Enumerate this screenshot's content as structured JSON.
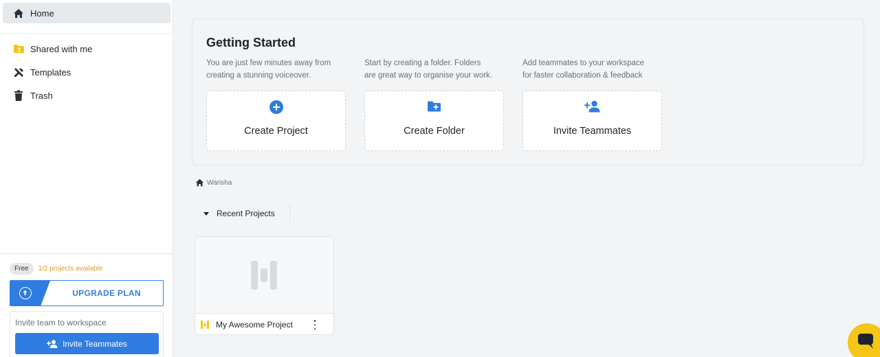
{
  "sidebar": {
    "items": [
      {
        "label": "Home",
        "icon": "home-icon"
      },
      {
        "label": "Shared with me",
        "icon": "shared-folder-icon"
      },
      {
        "label": "Templates",
        "icon": "templates-tools-icon"
      },
      {
        "label": "Trash",
        "icon": "trash-icon"
      }
    ],
    "plan_badge": "Free",
    "plan_status": "1/2 projects available",
    "upgrade_label": "UPGRADE PLAN",
    "invite_label": "Invite team to workspace",
    "invite_button": "Invite Teammates"
  },
  "getting_started": {
    "title": "Getting Started",
    "columns": [
      {
        "desc_line1": "You are just few minutes away from",
        "desc_line2": "creating a stunning voiceover.",
        "card_label": "Create Project",
        "icon": "plus-circle-icon"
      },
      {
        "desc_line1": "Start by creating a folder. Folders",
        "desc_line2": "are great way to organise your work.",
        "card_label": "Create Folder",
        "icon": "folder-plus-icon"
      },
      {
        "desc_line1": "Add teammates to your workspace",
        "desc_line2": "for faster collaboration & feedback",
        "card_label": "Invite Teammates",
        "icon": "add-person-icon"
      }
    ]
  },
  "breadcrumb": {
    "label": "Warisha",
    "icon": "home-icon"
  },
  "recent": {
    "toggle_label": "Recent Projects",
    "projects": [
      {
        "name": "My Awesome Project",
        "icon": "project-logo-icon"
      }
    ]
  },
  "colors": {
    "accent": "#2f7de1",
    "warning": "#e39a2a",
    "chat": "#f5c518",
    "project_logo": "#f5c518"
  }
}
